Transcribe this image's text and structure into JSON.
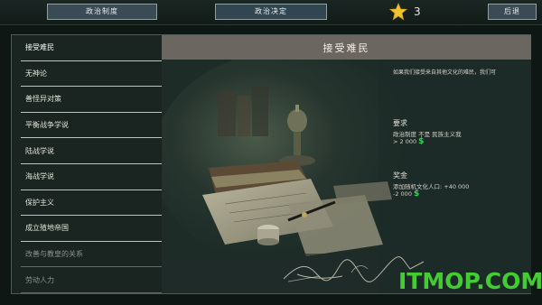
{
  "topbar": {
    "policy_system": "政治制度",
    "policy_decision": "政治决定",
    "back": "后退",
    "star_count": "3"
  },
  "list": {
    "items": [
      "接受难民",
      "无神论",
      "善怪异对策",
      "平衡战争学说",
      "陆战学说",
      "海战学说",
      "保护主义",
      "成立殖地帝国",
      "改善与教皇的关系",
      "劳动人力"
    ]
  },
  "detail": {
    "title": "接受难民",
    "description": "如果我们接受来自其他文化的难民，我们可",
    "requirements_header": "要求",
    "requirement_1": "政治制度 不是 民族主义我",
    "requirement_2": "> 2 000",
    "reward_header": "奖金",
    "reward_1": "添加随机文化人口: +40 000",
    "reward_2": "-2 000",
    "currency_symbol": "$"
  },
  "watermark": "ITMOP.COM",
  "colors": {
    "accent_green": "#37d456",
    "button_blue": "#3b4b55",
    "title_bar": "#6c6660"
  }
}
